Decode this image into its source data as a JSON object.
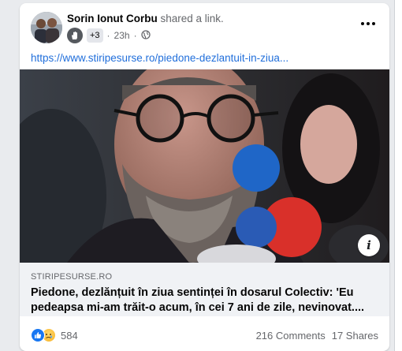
{
  "post": {
    "author_name": "Sorin Ionut Corbu",
    "author_action": "shared a link.",
    "plus_count": "+3",
    "time": "23h",
    "dot": "·",
    "link_url": "https://www.stiripesurse.ro/piedone-dezlantuit-in-ziua...",
    "preview_domain": "STIRIPESURSE.RO",
    "preview_title": "Piedone, dezlănțuit în ziua sentinței în dosarul Colectiv: 'Eu pedeapsa mi-am trăit-o acum, în cei 7 ani de zile, nevinovat....",
    "info_glyph": "i",
    "reaction_count": "584",
    "comments": "216 Comments",
    "shares": "17 Shares"
  },
  "icons": [
    "avatar",
    "hand-icon",
    "globe-icon",
    "more-icon",
    "info-icon",
    "like-reaction-icon",
    "sad-reaction-icon"
  ],
  "colors": {
    "link": "#216fdb",
    "like_blue": "#1877f2",
    "secondary_text": "#65676b",
    "preview_bg": "#f0f2f5"
  }
}
